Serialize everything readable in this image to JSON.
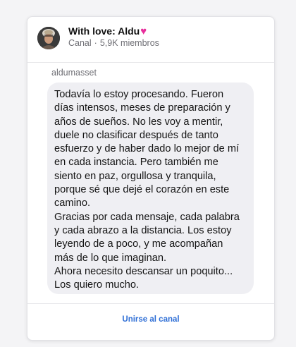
{
  "channel": {
    "title": "With love: Aldu",
    "title_emoji_icon": "heart-icon",
    "type": "Canal",
    "separator": "·",
    "members": "5,9K miembros"
  },
  "post": {
    "sender": "aldumasset",
    "lines": [
      "Todavía lo estoy procesando. Fueron",
      "días intensos, meses de preparación y",
      "años de sueños. No les voy a mentir,",
      "duele no clasificar después de tanto",
      "esfuerzo y de haber dado lo mejor de mí",
      "en cada instancia. Pero también me",
      "siento en paz, orgullosa y tranquila,",
      "porque sé que dejé el corazón en este",
      "camino.",
      "Gracias por cada mensaje, cada palabra",
      "y cada abrazo a la distancia. Los estoy",
      "leyendo de a poco, y me acompañan",
      "más de lo que imaginan.",
      "Ahora necesito descansar un poquito...",
      "Los quiero mucho."
    ]
  },
  "actions": {
    "join_label": "Unirse al canal"
  },
  "colors": {
    "accent": "#2f6fd6",
    "heart": "#e82e9c",
    "bubble": "#efeff3"
  }
}
